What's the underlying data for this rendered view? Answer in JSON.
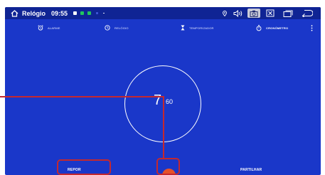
{
  "status_bar": {
    "app_title": "Relógio",
    "time": "09:55",
    "notification_colors": [
      "#ffffff",
      "#22c55e",
      "#22c55e"
    ],
    "icons": [
      "home-icon",
      "location-icon",
      "volume-icon",
      "screenshot-icon",
      "close-box-icon",
      "recent-apps-icon",
      "back-icon"
    ],
    "accent_active": "#c9cbd8"
  },
  "tabs": [
    {
      "label": "ALARME",
      "icon": "alarm-clock-icon",
      "selected": false
    },
    {
      "label": "RELÓGIO",
      "icon": "clock-icon",
      "selected": false
    },
    {
      "label": "TEMPORIZADOR",
      "icon": "hourglass-icon",
      "selected": false
    },
    {
      "label": "CRONÓMETRO",
      "icon": "stopwatch-icon",
      "selected": true
    }
  ],
  "stopwatch": {
    "value_main": "7",
    "value_fraction": "60"
  },
  "controls": {
    "reset_label": "REPOR",
    "play_icon": "play-icon",
    "share_label": "PARTILHAR"
  },
  "colors": {
    "background": "#1a37c9",
    "status_bar": "#0f2494",
    "play_button": "#e5512a",
    "annotation": "#c4282f"
  }
}
